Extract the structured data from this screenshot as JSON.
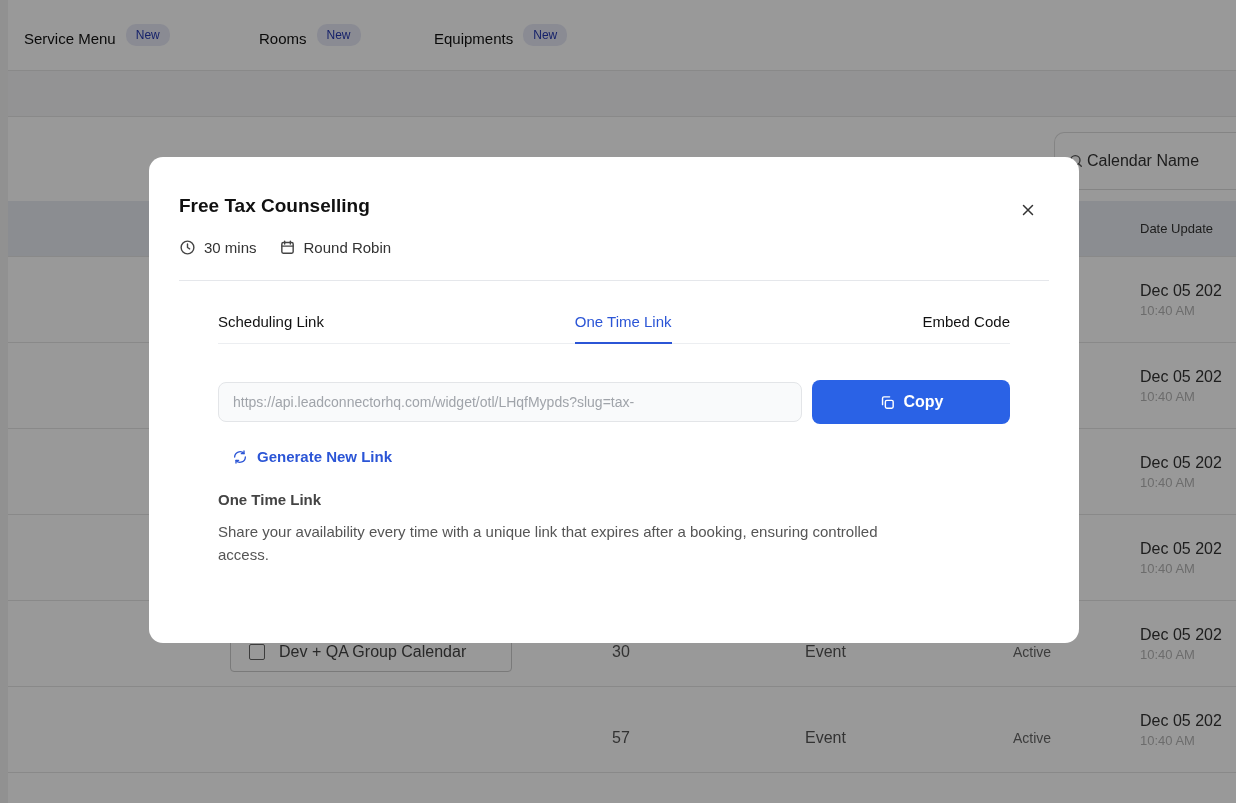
{
  "top_tabs": [
    {
      "label": "Service Menu",
      "badge": "New"
    },
    {
      "label": "Rooms",
      "badge": "New"
    },
    {
      "label": "Equipments",
      "badge": "New"
    }
  ],
  "search": {
    "placeholder": "Calendar Name"
  },
  "table": {
    "column_6_header": "Date Update",
    "rows": [
      {
        "date": "Dec 05 202",
        "time": "10:40 AM"
      },
      {
        "date": "Dec 05 202",
        "time": "10:40 AM"
      },
      {
        "date": "Dec 05 202",
        "time": "10:40 AM"
      },
      {
        "date": "Dec 05 202",
        "time": "10:40 AM"
      },
      {
        "calendar": "Dev + QA Group Calendar",
        "checked": false,
        "duration": "30",
        "type": "Event",
        "status": "Active",
        "date": "Dec 05 202",
        "time": "10:40 AM"
      },
      {
        "duration": "57",
        "type": "Event",
        "status": "Active",
        "date": "Dec 05 202",
        "time": "10:40 AM"
      }
    ]
  },
  "modal": {
    "title": "Free Tax Counselling",
    "meta": [
      {
        "kind": "duration",
        "text": "30 mins"
      },
      {
        "kind": "type",
        "text": "Round Robin"
      }
    ],
    "tabs": [
      {
        "label": "Scheduling Link",
        "selected": false
      },
      {
        "label": "One Time Link",
        "selected": true
      },
      {
        "label": "Embed Code",
        "selected": false
      }
    ],
    "link_field": {
      "value": "https://api.leadconnectorhq.com/widget/otl/LHqfMypds?slug=tax-"
    },
    "copy_button": "Copy",
    "generate_link": "Generate New Link",
    "info_title": "One Time Link",
    "info_text": "Share your availability every time with a unique link that expires after a booking, ensuring controlled access."
  }
}
